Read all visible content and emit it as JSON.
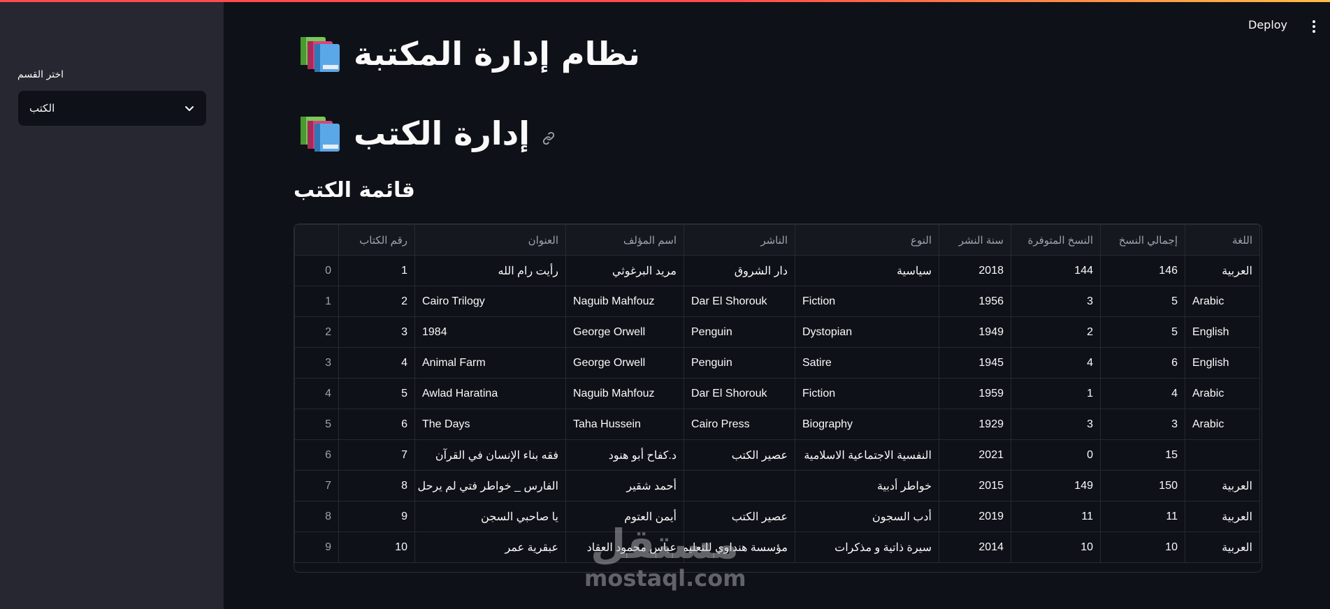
{
  "sidebar": {
    "label": "اختر القسم",
    "selected": "الكتب"
  },
  "header": {
    "deploy_label": "Deploy"
  },
  "main": {
    "title": "نظام إدارة المكتبة",
    "section_title": "إدارة الكتب",
    "subheader": "قائمة الكتب"
  },
  "table": {
    "columns": [
      "",
      "رقم الكتاب",
      "العنوان",
      "اسم المؤلف",
      "الناشر",
      "النوع",
      "سنة النشر",
      "النسخ المتوفرة",
      "إجمالي النسخ",
      "اللغة"
    ],
    "rows": [
      [
        "0",
        "1",
        "رأيت رام الله",
        "مريد البرغوثي",
        "دار الشروق",
        "سياسية",
        "2018",
        "144",
        "146",
        "العربية"
      ],
      [
        "1",
        "2",
        "Cairo Trilogy",
        "Naguib Mahfouz",
        "Dar El Shorouk",
        "Fiction",
        "1956",
        "3",
        "5",
        "Arabic"
      ],
      [
        "2",
        "3",
        "1984",
        "George Orwell",
        "Penguin",
        "Dystopian",
        "1949",
        "2",
        "5",
        "English"
      ],
      [
        "3",
        "4",
        "Animal Farm",
        "George Orwell",
        "Penguin",
        "Satire",
        "1945",
        "4",
        "6",
        "English"
      ],
      [
        "4",
        "5",
        "Awlad Haratina",
        "Naguib Mahfouz",
        "Dar El Shorouk",
        "Fiction",
        "1959",
        "1",
        "4",
        "Arabic"
      ],
      [
        "5",
        "6",
        "The Days",
        "Taha Hussein",
        "Cairo Press",
        "Biography",
        "1929",
        "3",
        "3",
        "Arabic"
      ],
      [
        "6",
        "7",
        "فقه بناء الإنسان في القرآن",
        "د.كفاح أبو هنود",
        "عصير الكتب",
        "النفسية الاجتماعية الاسلامية",
        "2021",
        "0",
        "15",
        ""
      ],
      [
        "7",
        "8",
        "الفارس _ خواطر فتي لم يرحل",
        "أحمد شقير",
        "",
        "خواطر أدبية",
        "2015",
        "149",
        "150",
        "العربية"
      ],
      [
        "8",
        "9",
        "يا صاحبي السجن",
        "أيمن العتوم",
        "عصير الكتب",
        "أدب السجون",
        "2019",
        "11",
        "11",
        "العربية"
      ],
      [
        "9",
        "10",
        "عبقرية عمر",
        "عباس محمود العقاد",
        "مؤسسة هنداوي للتعليم والثقافة",
        "سيرة ذاتية و مذكرات",
        "2014",
        "10",
        "10",
        "العربية"
      ]
    ]
  },
  "watermark": {
    "arabic": "مستقل",
    "latin": "mostaql.com"
  },
  "colors": {
    "sidebar_bg": "#262730",
    "main_bg": "#0e1117",
    "accent": "#ff4b4b"
  }
}
